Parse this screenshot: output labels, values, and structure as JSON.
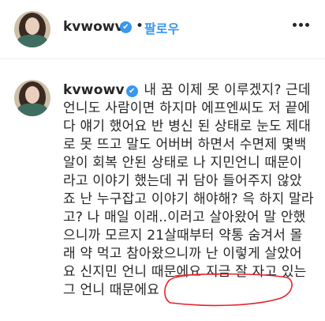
{
  "header": {
    "username": "kvwowv",
    "verified_icon": "✔",
    "separator": "•",
    "follow_label": "팔로우"
  },
  "comment": {
    "username": "kvwowv",
    "verified_icon": "✔",
    "text": "내 꿈 이제 못 이루겠지? 근데 언니도 사람이면 하지마 에프엔씨도 저 끝에 다 얘기 했어요 반 병신 된 상태로 눈도 제대로 못 뜨고 말도 어버버 하면서 수면제 몇백알이 회복 안된 상태로 나 지민언니 때문이라고 이야기 했는데 귀 담아 들어주지 않았죠 난 누구잡고 이야기 해야해? 윽 하지 말라고? 나 매일 이래..이러고 살아왔어 말 안했으니까 모르지 21살때부터 약통 숨겨서 몰래 약 먹고 참아왔으니까 난 이렇게 살았어요 신지민 언니 때문에요 지금 잘 자고 있는 그 언니 때문에요"
  },
  "colors": {
    "accent": "#3897f0",
    "text": "#262626",
    "highlight_circle": "#e8212b"
  },
  "icons": {
    "more": "more-options-icon",
    "verified": "verified-badge-icon"
  }
}
